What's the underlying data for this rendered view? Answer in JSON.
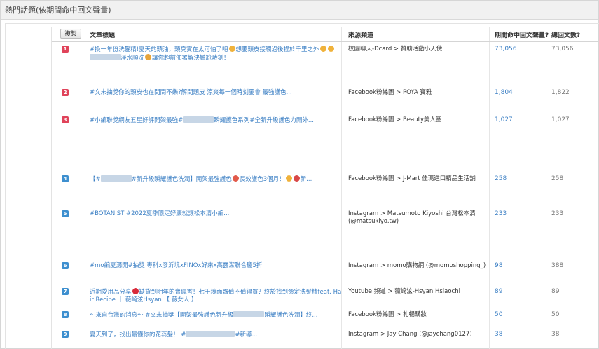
{
  "panel": {
    "title": "熱門話題(依期間命中回文聲量)"
  },
  "table": {
    "copy_label": "複製",
    "headers": {
      "title": "文章標題",
      "source": "來源頻道",
      "period": "期間命中回文聲量?",
      "total": "總回文數?"
    },
    "rows": [
      {
        "rank": "1",
        "rank_color": "#e0435a",
        "title_a": "#換一年份洗髮精!夏天的頭油，頭臭實在太可怕了吧",
        "title_b": "想要頭皮接觸過後捏於千里之外",
        "title_c": "淨水順洗",
        "title_d": "讓你超前佈署解決尷尬時刻！",
        "source": "校園聊天-Dcard > 贊助活動小天使",
        "period": "73,056",
        "total": "73,056"
      },
      {
        "rank": "2",
        "rank_color": "#e0435a",
        "title": "#文末抽獎你的頭皮也在問問不樂?解問題皮 涼爽每一個時刻要會 最強護色...",
        "source": "Facebook粉絲團 > POYA 寶雅",
        "period": "1,804",
        "total": "1,822"
      },
      {
        "rank": "3",
        "rank_color": "#e0435a",
        "title_a": "#小編聯獎網友五星好評開架最強#",
        "title_b": "瞬耀護色系列#全新升級護色力開外...",
        "source": "Facebook粉絲團 > Beauty美人圈",
        "period": "1,027",
        "total": "1,027"
      },
      {
        "rank": "4",
        "rank_color": "#3d8fcf",
        "title_a": "【#",
        "title_b": "#新升級瞬耀護色洗潤】開架最強護色",
        "title_c": "長效護色3個月！",
        "title_d": "新...",
        "source": "Facebook粉絲團 > J-Mart 佳瑪進口精品生活舖",
        "period": "258",
        "total": "258"
      },
      {
        "rank": "5",
        "rank_color": "#3d8fcf",
        "title": "#BOTANIST #2022夏季限定好康就讓松本清小編...",
        "source": "Instagram > Matsumoto Kiyoshi 台灣松本清 (@matsukiyo.tw)",
        "period": "233",
        "total": "233"
      },
      {
        "rank": "6",
        "rank_color": "#3d8fcf",
        "title": "#mo編夏源開#抽獎 專科x彦沂境xFINOx好來x高露潔聯合慶5折",
        "source": "Instagram > momo購物網 (@momoshopping_)",
        "period": "98",
        "total": "388"
      },
      {
        "rank": "7",
        "rank_color": "#3d8fcf",
        "title_a": "近期愛用品分享",
        "title_b": "缺貨到明年的賣瘋香！七千塊面霜值不值得買？終於找到命定洗髮精feat. Hair Recipe ｜ 薇崎泫Hsyan 【 薇女人 】",
        "source": "Youtube 頻道 > 薇崎泫-Hsyan Hsiaochi",
        "period": "89",
        "total": "89"
      },
      {
        "rank": "8",
        "rank_color": "#3d8fcf",
        "title": "～來自台灣的消息～ #文末抽獎【開架最強護色新升級",
        "title_b": "瞬耀護色洗潤】終...",
        "source": "Facebook粉絲團 > 札暢購妝",
        "period": "50",
        "total": "50"
      },
      {
        "rank": "9",
        "rank_color": "#3d8fcf",
        "title_a": "夏天到了，找出最懂你的花蕊髮！ #",
        "title_b": "#新導...",
        "source": "Instagram > Jay Chang (@jaychang0127)",
        "period": "38",
        "total": "38"
      }
    ]
  }
}
